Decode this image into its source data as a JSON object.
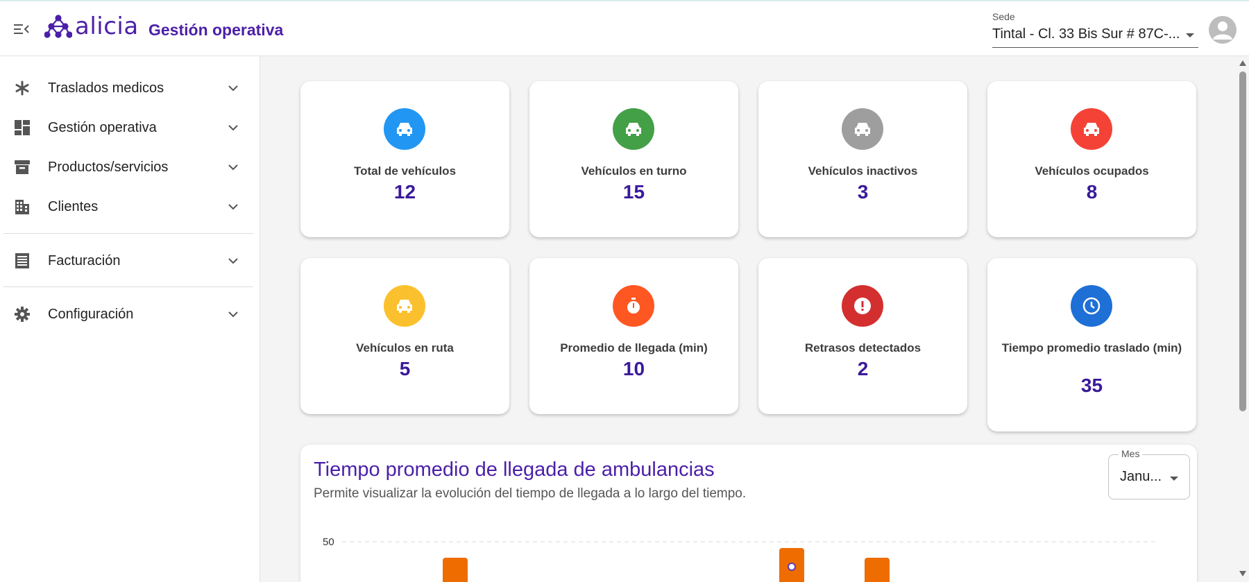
{
  "header": {
    "logo_text": "alicia",
    "title": "Gestión operativa",
    "sede_label": "Sede",
    "sede_value": "Tintal - Cl. 33 Bis Sur # 87C-...",
    "brand_color": "#4b1fa8"
  },
  "sidebar": {
    "items": [
      {
        "label": "Traslados medicos",
        "icon": "asterisk-icon"
      },
      {
        "label": "Gestión operativa",
        "icon": "dashboard-icon"
      },
      {
        "label": "Productos/servicios",
        "icon": "archive-icon"
      },
      {
        "label": "Clientes",
        "icon": "building-icon"
      },
      {
        "label": "Facturación",
        "icon": "receipt-icon"
      },
      {
        "label": "Configuración",
        "icon": "gear-icon"
      }
    ]
  },
  "cards": [
    {
      "title": "Total de vehículos",
      "value": "12",
      "icon": "car-icon",
      "color": "#2196f3"
    },
    {
      "title": "Vehículos en turno",
      "value": "15",
      "icon": "car-icon",
      "color": "#43a047"
    },
    {
      "title": "Vehículos inactivos",
      "value": "3",
      "icon": "car-icon",
      "color": "#9e9e9e"
    },
    {
      "title": "Vehículos ocupados",
      "value": "8",
      "icon": "car-icon",
      "color": "#f44336"
    },
    {
      "title": "Vehículos en ruta",
      "value": "5",
      "icon": "car-icon",
      "color": "#fbc02d"
    },
    {
      "title": "Promedio de llegada (min)",
      "value": "10",
      "icon": "stopwatch-icon",
      "color": "#ff5722"
    },
    {
      "title": "Retrasos detectados",
      "value": "2",
      "icon": "alert-icon",
      "color": "#d32f2f"
    },
    {
      "title": "Tiempo promedio traslado (min)",
      "value": "35",
      "icon": "clock-icon",
      "color": "#1e6fd6"
    }
  ],
  "chart_panel": {
    "title": "Tiempo promedio de llegada de ambulancias",
    "subtitle": "Permite visualizar la evolución del tiempo de llegada a lo largo del tiempo.",
    "month_label": "Mes",
    "month_value": "Janu..."
  },
  "chart_data": {
    "type": "bar",
    "y_ticks": [
      "50"
    ],
    "bar_color": "#ef6c00",
    "grid": true
  }
}
